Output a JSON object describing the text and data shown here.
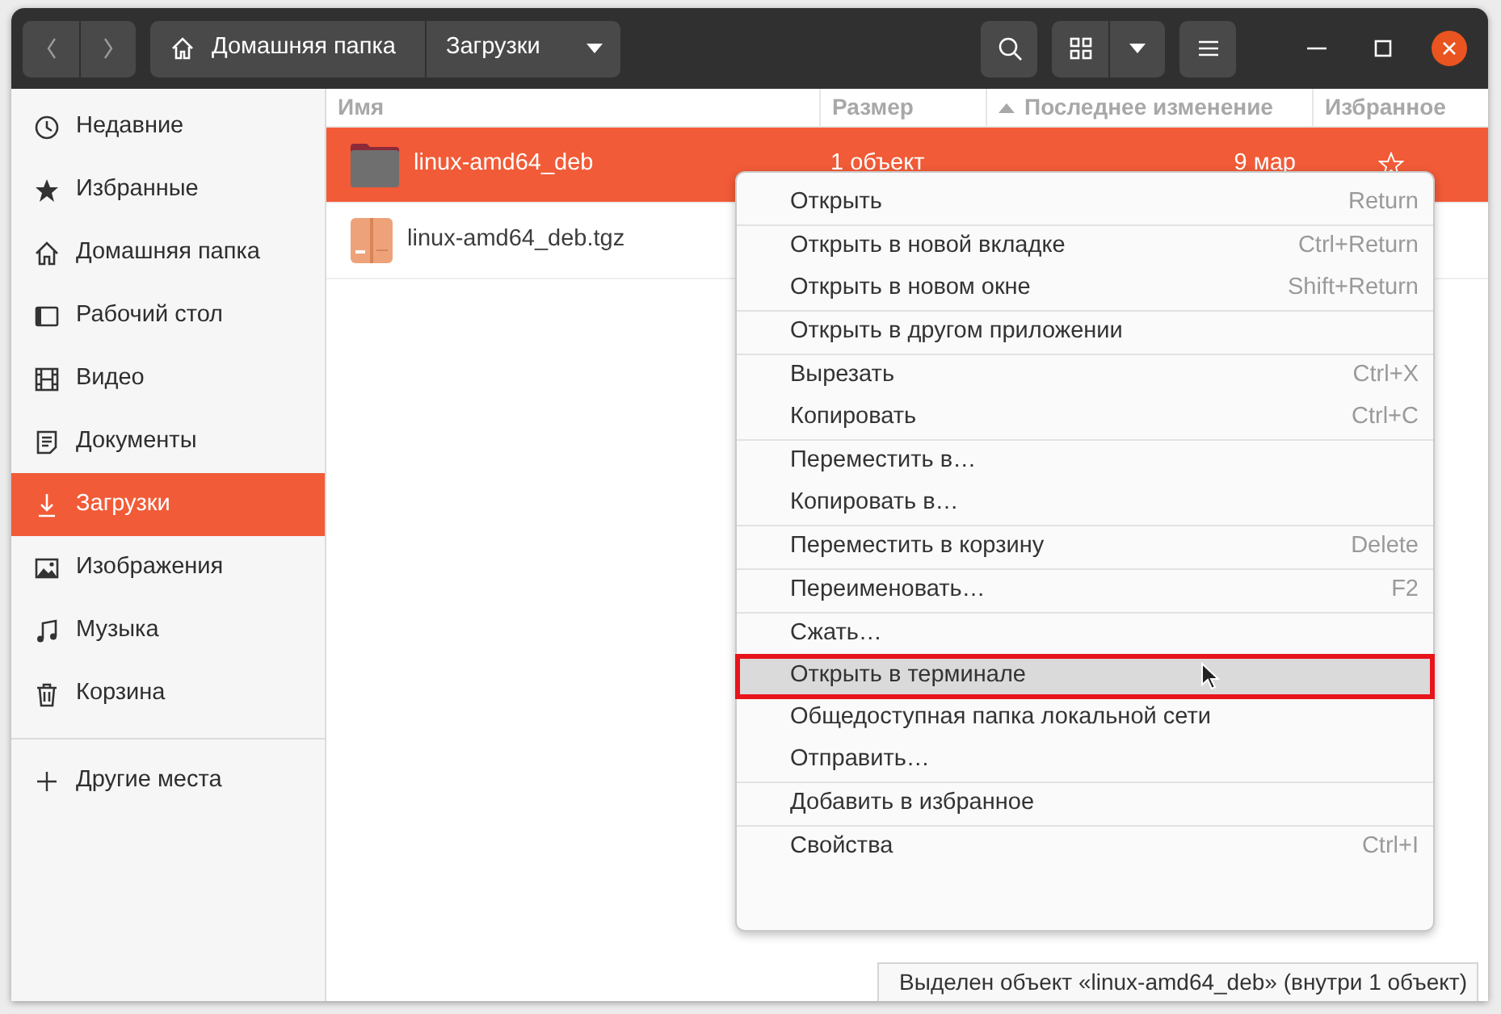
{
  "path_bar": [
    {
      "label": "Домашняя папка",
      "kind": "home"
    },
    {
      "label": "Загрузки",
      "kind": "current"
    }
  ],
  "sidebar": {
    "items": [
      {
        "label": "Недавние",
        "selected": false
      },
      {
        "label": "Избранные",
        "selected": false
      },
      {
        "label": "Домашняя папка",
        "selected": false
      },
      {
        "label": "Рабочий стол",
        "selected": false
      },
      {
        "label": "Видео",
        "selected": false
      },
      {
        "label": "Документы",
        "selected": false
      },
      {
        "label": "Загрузки",
        "selected": true
      },
      {
        "label": "Изображения",
        "selected": false
      },
      {
        "label": "Музыка",
        "selected": false
      },
      {
        "label": "Корзина",
        "selected": false
      }
    ],
    "other_places": "Другие места"
  },
  "file_list": {
    "columns": [
      {
        "label": "Имя"
      },
      {
        "label": "Размер"
      },
      {
        "label": "Последнее изменение",
        "sorted": true
      },
      {
        "label": "Избранное"
      }
    ],
    "rows": [
      {
        "name": "linux-amd64_deb",
        "kind": "folder",
        "size": "1 объект",
        "modified": "9 мар",
        "favorite": false,
        "selected": true
      },
      {
        "name": "linux-amd64_deb.tgz",
        "kind": "archive",
        "selected": false
      }
    ]
  },
  "context_menu": {
    "groups": [
      [
        {
          "label": "Открыть",
          "shortcut": "Return",
          "selected": false
        }
      ],
      [
        {
          "label": "Открыть в новой вкладке",
          "shortcut": "Ctrl+Return",
          "selected": false
        },
        {
          "label": "Открыть в новом окне",
          "shortcut": "Shift+Return",
          "selected": false
        }
      ],
      [
        {
          "label": "Открыть в другом приложении",
          "selected": false
        }
      ],
      [
        {
          "label": "Вырезать",
          "shortcut": "Ctrl+X",
          "selected": false
        },
        {
          "label": "Копировать",
          "shortcut": "Ctrl+C",
          "selected": false
        }
      ],
      [
        {
          "label": "Переместить в…",
          "selected": false
        },
        {
          "label": "Копировать в…",
          "selected": false
        }
      ],
      [
        {
          "label": "Переместить в корзину",
          "shortcut": "Delete",
          "selected": false
        }
      ],
      [
        {
          "label": "Переименовать…",
          "shortcut": "F2",
          "selected": false
        }
      ],
      [
        {
          "label": "Сжать…",
          "selected": false
        },
        {
          "label": "Открыть в терминале",
          "selected": true,
          "annotated": true
        },
        {
          "label": "Общедоступная папка локальной сети",
          "selected": false
        },
        {
          "label": "Отправить…",
          "selected": false
        }
      ],
      [
        {
          "label": "Добавить в избранное",
          "selected": false
        }
      ],
      [
        {
          "label": "Свойства",
          "shortcut": "Ctrl+I",
          "selected": false
        }
      ]
    ]
  },
  "status_bar": "Выделен объект «linux-amd64_deb»  (внутри 1 объект)"
}
